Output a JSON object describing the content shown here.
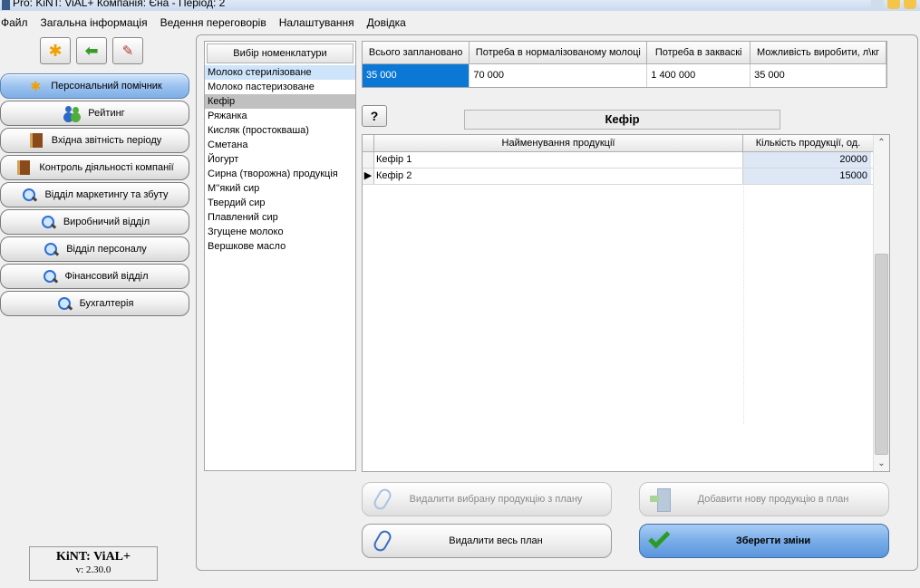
{
  "window": {
    "title": "Pro: KiNT: ViAL+    Компанія: Єна - Період: 2"
  },
  "menu": [
    "Файл",
    "Загальна інформація",
    "Ведення переговорів",
    "Налаштування",
    "Довідка"
  ],
  "sidebar": {
    "toolbar_icons": [
      "sun-icon",
      "back-arrow-icon",
      "tools-icon"
    ],
    "items": [
      {
        "label": "Персональний помічник",
        "icon": "sun-icon",
        "active": true
      },
      {
        "label": "Рейтинг",
        "icon": "people-icon"
      },
      {
        "label": "Вхідна звітність періоду",
        "icon": "book-icon"
      },
      {
        "label": "Контроль діяльності компанії",
        "icon": "book-icon"
      },
      {
        "label": "Відділ маркетингу та збуту",
        "icon": "magnifier-icon"
      },
      {
        "label": "Виробничий відділ",
        "icon": "magnifier-icon"
      },
      {
        "label": "Відділ персоналу",
        "icon": "magnifier-icon"
      },
      {
        "label": "Фінансовий відділ",
        "icon": "magnifier-icon"
      },
      {
        "label": "Бухгалтерія",
        "icon": "magnifier-icon"
      }
    ],
    "brand_name": "KiNT: ViAL+",
    "version": "v: 2.30.0"
  },
  "nomenclature": {
    "header": "Вибір номенклатури",
    "items": [
      "Молоко стерилізоване",
      "Молоко пастеризоване",
      "Кефір",
      "Ряжанка",
      "Кисляк (простокваша)",
      "Сметана",
      "Йогурт",
      "Сирна (творожна) продукція",
      "М''який сир",
      "Твердий сир",
      "Плавлений сир",
      "Згущене молоко",
      "Вершкове масло"
    ],
    "selected": "Кефір",
    "hovered": "Молоко стерилізоване"
  },
  "plan_summary": {
    "headers": [
      "Всього заплановано",
      "Потреба в нормалізованому молоці",
      "Потреба в закваскі",
      "Можливість виробити, л\\кг"
    ],
    "values": [
      "35 000",
      "70 000",
      "1 400 000",
      "35 000"
    ]
  },
  "help_label": "?",
  "product": {
    "title": "Кефір",
    "headers": [
      "Найменування продукції",
      "Кількість продукції, од."
    ],
    "rows": [
      {
        "name": "Кефір 1",
        "qty": "20000"
      },
      {
        "name": "Кефір 2",
        "qty": "15000"
      }
    ]
  },
  "actions": {
    "delete_selected": "Видалити вибрану продукцію з плану",
    "add_new": "Добавити нову продукцію в план",
    "delete_all": "Видалити весь план",
    "save": "Зберегти зміни"
  },
  "colors": {
    "selection": "#0b78d6",
    "active_nav": "#9cc3ef",
    "save_button": "#79ade9"
  }
}
